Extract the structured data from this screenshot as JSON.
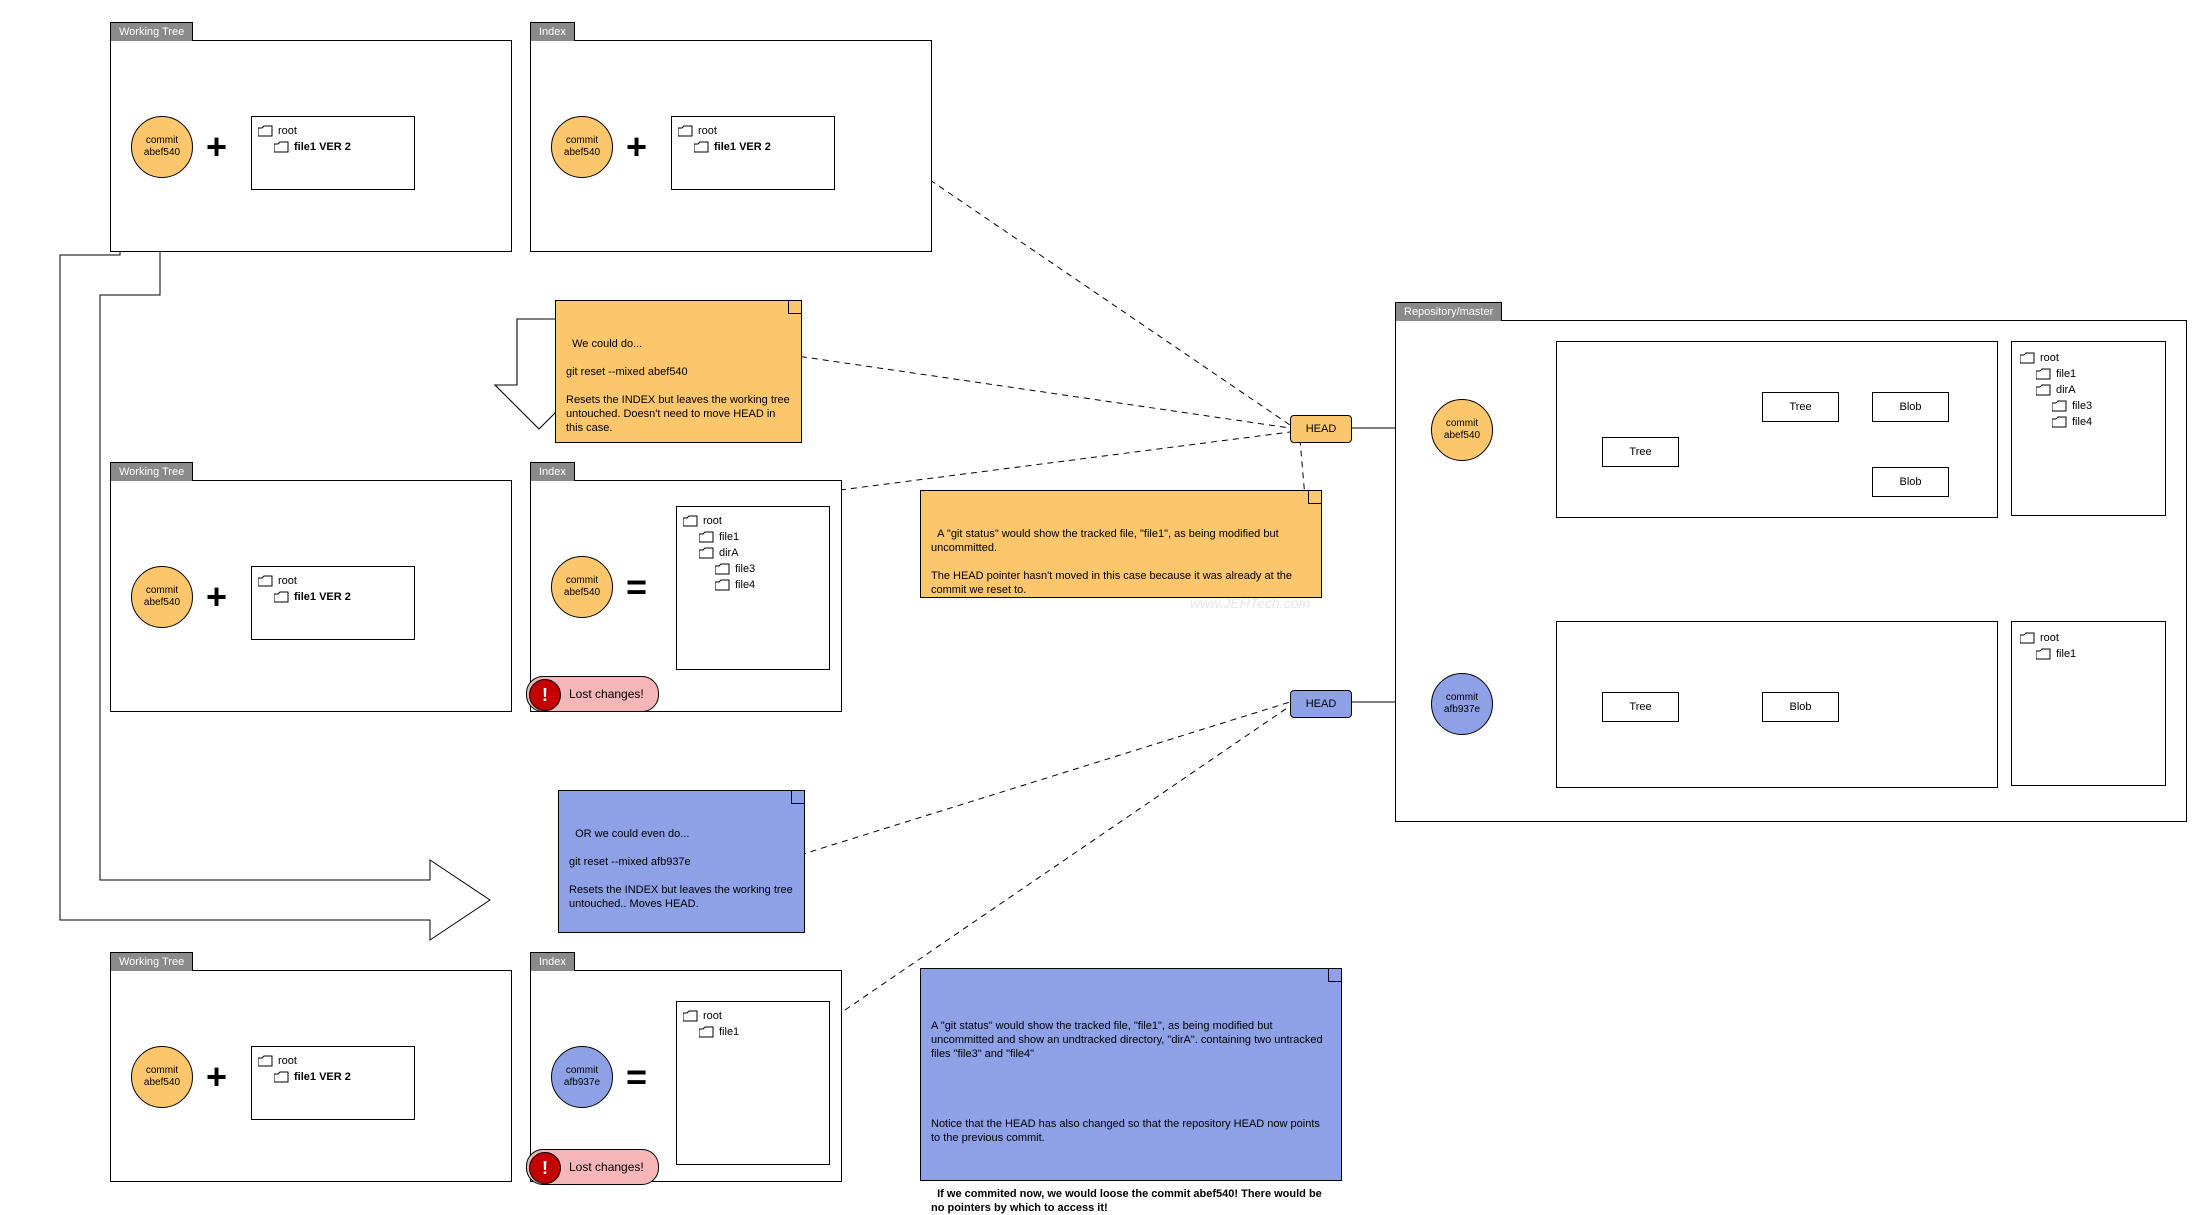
{
  "labels": {
    "working_tree": "Working Tree",
    "index": "Index",
    "repository": "Repository/master",
    "commit": "commit",
    "root": "root",
    "file1ver2": "file1 VER 2",
    "file1": "file1",
    "dirA": "dirA",
    "file3": "file3",
    "file4": "file4",
    "head": "HEAD",
    "tree": "Tree",
    "blob": "Blob",
    "lost": "Lost changes!"
  },
  "commits": {
    "c1": "abef540",
    "c2": "afb937e"
  },
  "notes": {
    "n1": "We could do...\n\ngit reset --mixed abef540\n\nResets the INDEX but leaves the working tree untouched. Doesn't need to move HEAD in this case.",
    "n2": "A \"git status\" would show the tracked file, \"file1\", as being modified but uncommitted.\n\nThe HEAD pointer hasn't moved in this case because it was already at the commit we reset to.",
    "n3": "OR we could even do...\n\ngit reset --mixed afb937e\n\nResets the INDEX but leaves the working tree untouched.. Moves HEAD.",
    "n4_p1": "A \"git status\" would show the tracked file, \"file1\", as being modified but uncommitted and show an undtracked directory, \"dirA\". containing two untracked files \"file3\" and \"file4\"",
    "n4_p2": "Notice that the HEAD has also changed so that the repository HEAD now points to the previous commit.",
    "n4_p3": "If we commited now, we would loose the commit abef540! There would be no pointers by which to access it!"
  },
  "watermark": "www.JEHTech.com"
}
